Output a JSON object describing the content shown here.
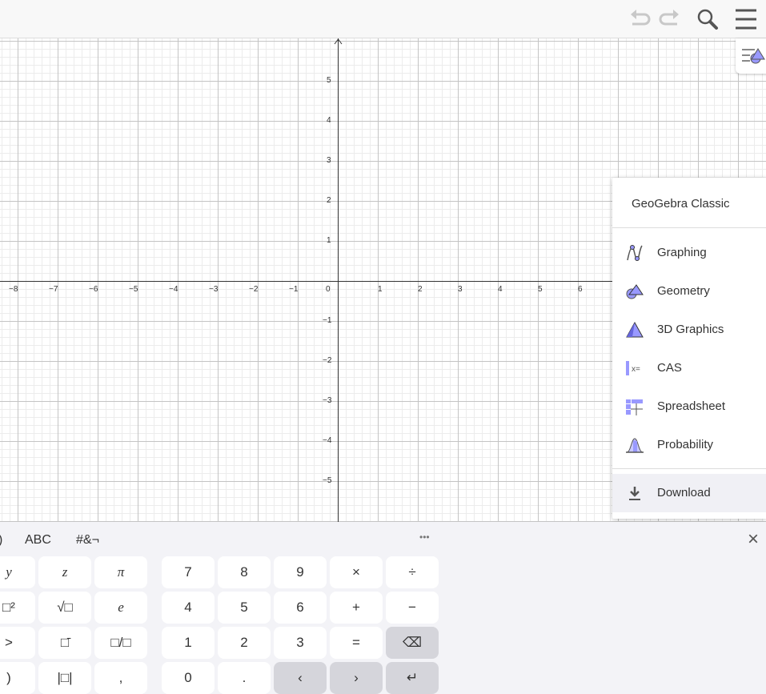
{
  "toolbar": {
    "icons": [
      "undo-icon",
      "redo-icon",
      "search-icon",
      "menu-icon"
    ]
  },
  "graph": {
    "x_ticks": [
      "−8",
      "−7",
      "−6",
      "−5",
      "−4",
      "−3",
      "−2",
      "−1",
      "1",
      "2",
      "3",
      "4",
      "5",
      "6"
    ],
    "x_values": [
      -8,
      -7,
      -6,
      -5,
      -4,
      -3,
      -2,
      -1,
      1,
      2,
      3,
      4,
      5,
      6
    ],
    "y_ticks": [
      "5",
      "4",
      "3",
      "2",
      "1",
      "−1",
      "−2",
      "−3",
      "−4",
      "−5"
    ],
    "y_values": [
      5,
      4,
      3,
      2,
      1,
      -1,
      -2,
      -3,
      -4,
      -5
    ],
    "origin": "0"
  },
  "menu": {
    "title": "GeoGebra Classic",
    "items": [
      {
        "label": "Graphing",
        "icon": "graphing-icon"
      },
      {
        "label": "Geometry",
        "icon": "geometry-icon"
      },
      {
        "label": "3D Graphics",
        "icon": "3d-graphics-icon"
      },
      {
        "label": "CAS",
        "icon": "cas-icon"
      },
      {
        "label": "Spreadsheet",
        "icon": "spreadsheet-icon"
      },
      {
        "label": "Probability",
        "icon": "probability-icon"
      }
    ],
    "download": "Download"
  },
  "keyboard": {
    "tabs": [
      ")",
      "ABC",
      "#&¬"
    ],
    "more": "•••",
    "close": "×",
    "rows": [
      [
        "y",
        "z",
        "π",
        "7",
        "8",
        "9",
        "×",
        "÷"
      ],
      [
        "□²",
        "√□",
        "e",
        "4",
        "5",
        "6",
        "+",
        "−"
      ],
      [
        ">",
        "□̄",
        "□/□",
        "1",
        "2",
        "3",
        "=",
        "⌫"
      ],
      [
        ")",
        "|□|",
        ",",
        "0",
        ".",
        "‹",
        "›",
        "↵"
      ]
    ]
  },
  "colors": {
    "accent": "#9999ff",
    "key_gray": "#d5d5db"
  }
}
